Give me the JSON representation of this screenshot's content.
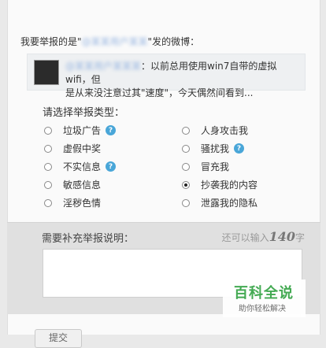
{
  "report": {
    "prefix": "我要举报的是\"",
    "blurred_user": "@某某用户某某",
    "suffix": "\"发的微博："
  },
  "quote": {
    "blurred_user": "@某某用户某某某",
    "text_line1": "：以前总用使用win7自带的虚拟wifi，但",
    "text_line2": "是从来没注意过其\"速度\"，今天偶然间看到..."
  },
  "type_title": "请选择举报类型：",
  "options": [
    {
      "label": "垃圾广告",
      "help": true,
      "checked": false
    },
    {
      "label": "人身攻击我",
      "help": false,
      "checked": false
    },
    {
      "label": "虚假中奖",
      "help": false,
      "checked": false
    },
    {
      "label": "骚扰我",
      "help": true,
      "checked": false
    },
    {
      "label": "不实信息",
      "help": true,
      "checked": false
    },
    {
      "label": "冒充我",
      "help": false,
      "checked": false
    },
    {
      "label": "敏感信息",
      "help": false,
      "checked": false
    },
    {
      "label": "抄袭我的内容",
      "help": false,
      "checked": true
    },
    {
      "label": "淫秽色情",
      "help": false,
      "checked": false
    },
    {
      "label": "泄露我的隐私",
      "help": false,
      "checked": false
    }
  ],
  "help_glyph": "?",
  "supplement": {
    "label": "需要补充举报说明：",
    "counter_prefix": "还可以输入",
    "counter_num": "140",
    "counter_suffix": "字",
    "textarea_value": ""
  },
  "watermark": {
    "main": "百科全说",
    "sub": "助你轻松解决"
  },
  "submit_label": "提交",
  "colors": {
    "help": "#49a6d8",
    "watermark": "#3aa64a"
  }
}
